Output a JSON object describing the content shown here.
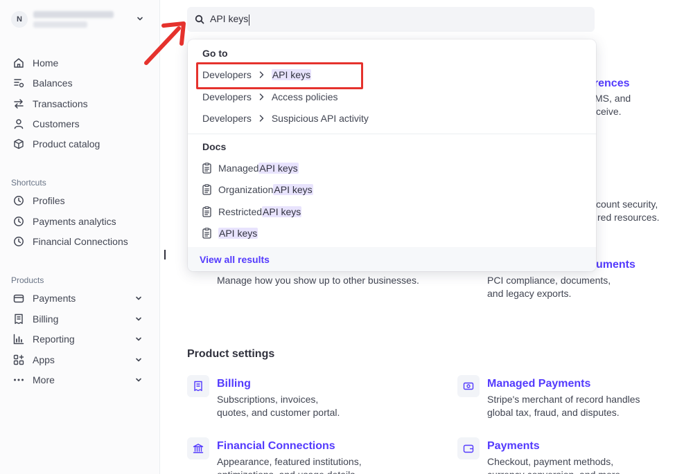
{
  "account": {
    "initial": "N"
  },
  "nav": {
    "primary": [
      {
        "label": "Home",
        "icon": "home-icon"
      },
      {
        "label": "Balances",
        "icon": "balances-icon"
      },
      {
        "label": "Transactions",
        "icon": "transactions-icon"
      },
      {
        "label": "Customers",
        "icon": "customers-icon"
      },
      {
        "label": "Product catalog",
        "icon": "product-catalog-icon"
      }
    ],
    "shortcuts_label": "Shortcuts",
    "shortcuts": [
      {
        "label": "Profiles",
        "icon": "clock-icon"
      },
      {
        "label": "Payments analytics",
        "icon": "clock-icon"
      },
      {
        "label": "Financial Connections",
        "icon": "clock-icon"
      }
    ],
    "products_label": "Products",
    "products": [
      {
        "label": "Payments",
        "icon": "payments-icon"
      },
      {
        "label": "Billing",
        "icon": "billing-icon"
      },
      {
        "label": "Reporting",
        "icon": "reporting-icon"
      },
      {
        "label": "Apps",
        "icon": "apps-icon"
      },
      {
        "label": "More",
        "icon": "more-icon"
      }
    ]
  },
  "search": {
    "value": "API keys"
  },
  "dropdown": {
    "goto_label": "Go to",
    "goto": [
      {
        "parent": "Developers",
        "child": "API keys",
        "child_highlighted": true
      },
      {
        "parent": "Developers",
        "child": "Access policies",
        "child_highlighted": false
      },
      {
        "parent": "Developers",
        "child": "Suspicious API activity",
        "child_highlighted": false
      }
    ],
    "docs_label": "Docs",
    "docs": [
      {
        "prefix": "Managed ",
        "match": "API keys"
      },
      {
        "prefix": "Organization ",
        "match": "API keys"
      },
      {
        "prefix": "Restricted ",
        "match": "API keys"
      },
      {
        "prefix": "",
        "match": "API keys"
      }
    ],
    "footer": "View all results"
  },
  "background": {
    "peek_link_1": "erences",
    "peek_desc_1a": "MS, and",
    "peek_desc_1b": "ceive.",
    "peek_desc_2a": "count security,",
    "peek_desc_2b": "red resources.",
    "peek_link_3": "uments",
    "left_desc": "Manage how you show up to other businesses.",
    "right_desc_a": "PCI compliance, documents,",
    "right_desc_b": "and legacy exports.",
    "product_settings": "Product settings",
    "cards": [
      {
        "title": "Billing",
        "line1": "Subscriptions, invoices,",
        "line2": "quotes, and customer portal.",
        "icon": "billing-settings-icon"
      },
      {
        "title": "Managed Payments",
        "line1": "Stripe's merchant of record handles",
        "line2": "global tax, fraud, and disputes.",
        "icon": "managed-payments-icon"
      },
      {
        "title": "Financial Connections",
        "line1": "Appearance, featured institutions,",
        "line2": "optimizations, and usage details.",
        "icon": "bank-icon"
      },
      {
        "title": "Payments",
        "line1": "Checkout, payment methods,",
        "line2": "currency conversion, and more.",
        "icon": "wallet-icon"
      }
    ]
  },
  "colors": {
    "accent": "#533afd",
    "highlight": "#e8e3fd",
    "annotation_red": "#e5322d"
  }
}
